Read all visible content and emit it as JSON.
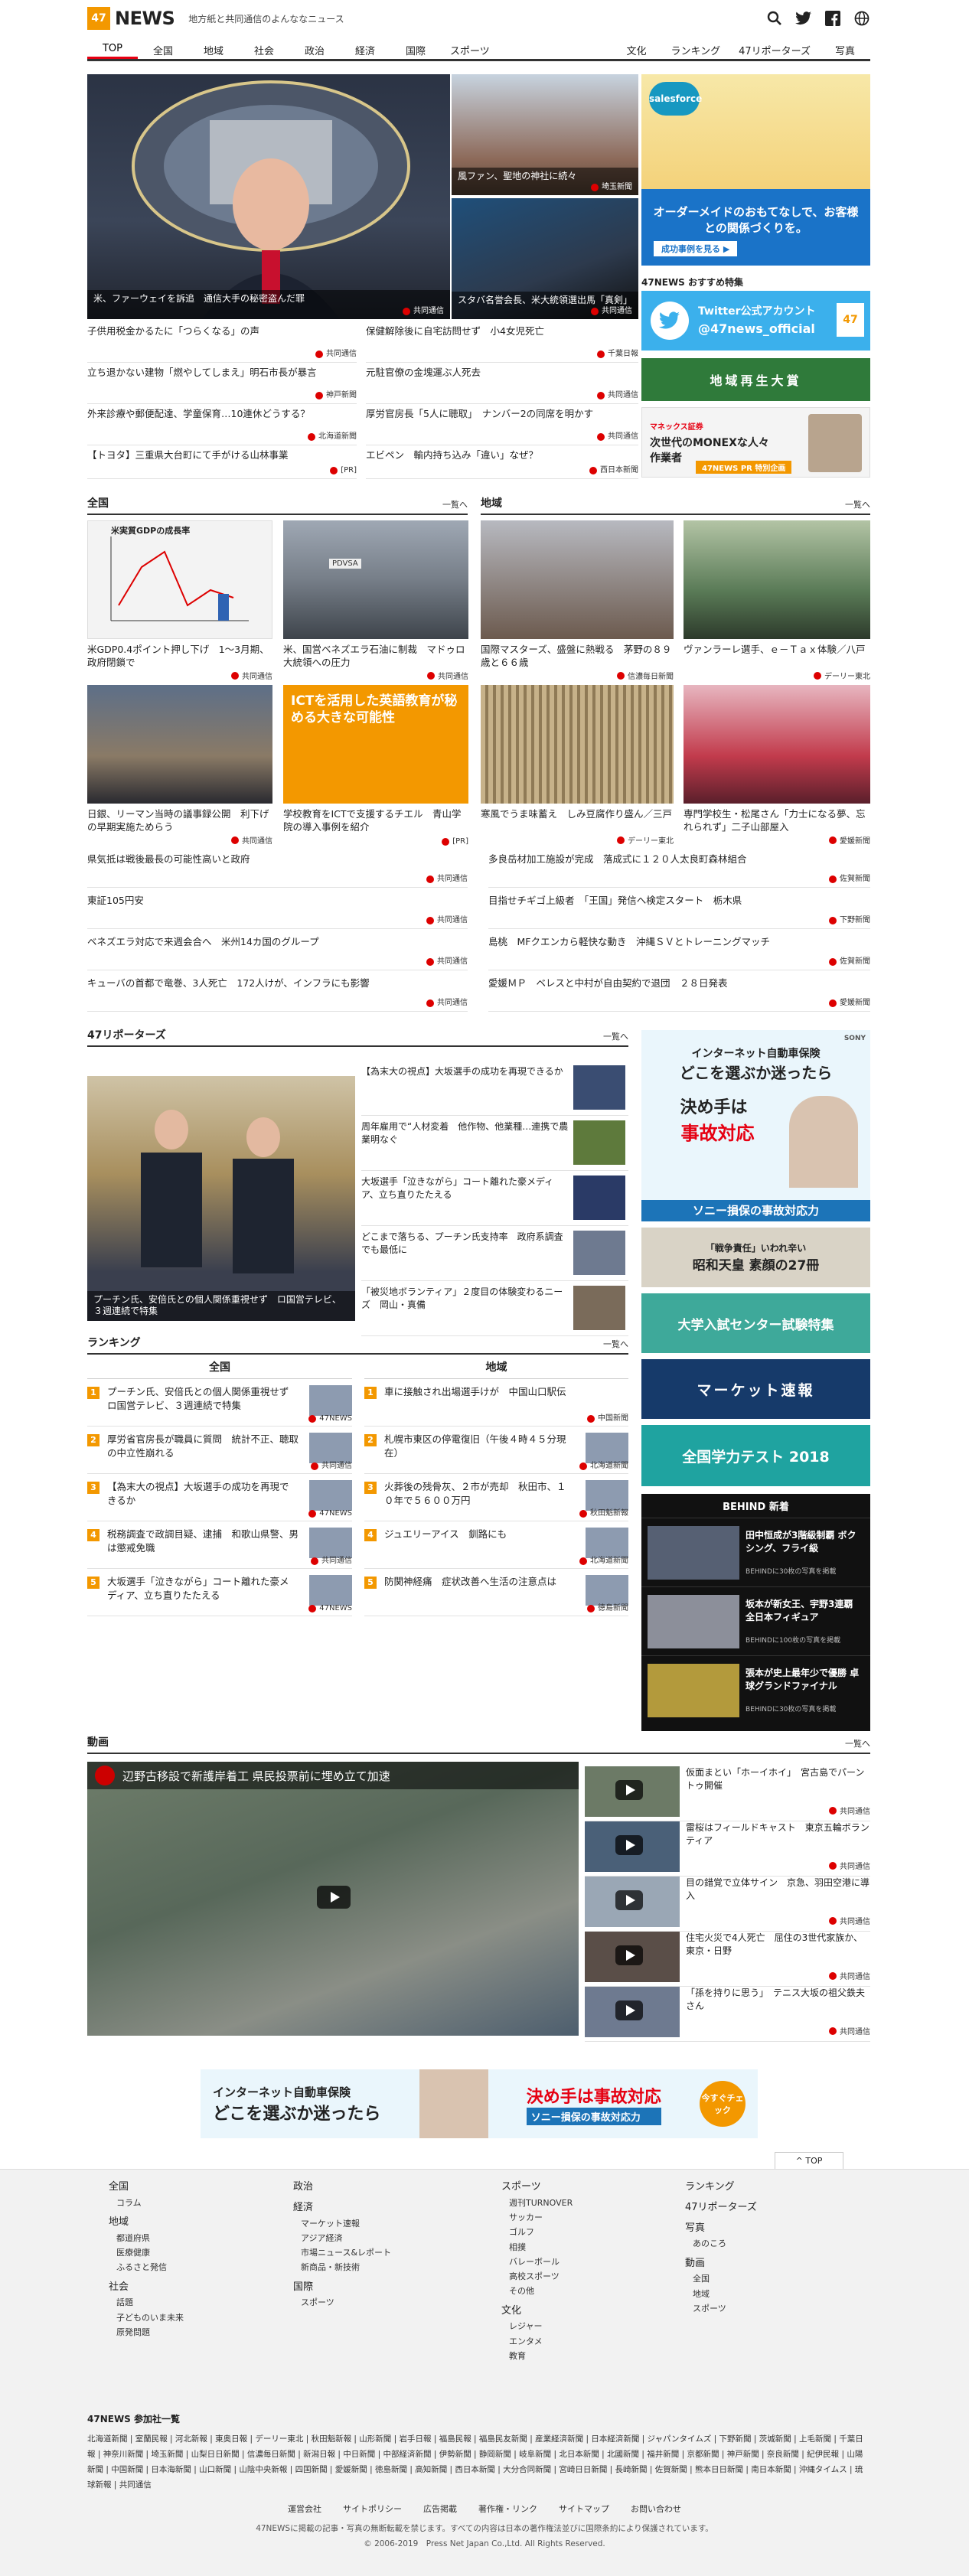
{
  "header": {
    "logo_num": "47",
    "logo_text": "NEWS",
    "tagline": "地方紙と共同通信のよんななニュース"
  },
  "nav": [
    "TOP",
    "全国",
    "地域",
    "社会",
    "政治",
    "経済",
    "国際",
    "スポーツ",
    "文化",
    "ランキング",
    "47リポーターズ",
    "写真"
  ],
  "hero": {
    "main_caption": "米、ファーウェイを訴追　通信大手の秘密盗んだ罪",
    "main_src": "共同通信",
    "side1_caption": "風ファン、聖地の神社に続々",
    "side1_src": "埼玉新聞",
    "side2_caption": "スタバ名誉会長、米大統領選出馬「真剣」",
    "side2_src": "共同通信"
  },
  "top_headlines": [
    {
      "t": "子供用税金かるたに「つらくなる」の声",
      "s": "共同通信"
    },
    {
      "t": "保健解除後に自宅訪問せず　小4女児死亡",
      "s": "千葉日報"
    },
    {
      "t": "立ち退かない建物「燃やしてしまえ」明石市長が暴言",
      "s": "神戸新聞"
    },
    {
      "t": "元駐官僚の金塊運ぶ人死去",
      "s": "共同通信"
    },
    {
      "t": "外来診療や郵便配達、学童保育…10連休どうする？",
      "s": "北海道新聞"
    },
    {
      "t": "厚労官房長「5人に聴取」　ナンバー2の同席を明かす",
      "s": "共同通信"
    },
    {
      "t": "【トヨタ】三重県大台町にて手がける山林事業",
      "s": "[PR]"
    },
    {
      "t": "エビペン　輸内持ち込み「違い」なぜ？",
      "s": "西日本新聞"
    }
  ],
  "right_ads": {
    "salesforce_title": "オーダーメイドのおもてなしで、お客様との関係づくりを。",
    "salesforce_btn": "成功事例を見る ▶",
    "recommend_title": "47NEWS おすすめ特集",
    "twitter_title": "Twitter公式アカウント",
    "twitter_handle": "@47news_official",
    "chiiki": "地域再生大賞",
    "monex_brand": "マネックス証券",
    "monex_title": "次世代のMONEXな人々",
    "monex_sub": "作業者",
    "monex_pr": "47NEWS PR 特別企画"
  },
  "zenkoku": {
    "title": "全国",
    "more": "一覧へ",
    "cards": [
      {
        "t": "米GDP0.4ポイント押し下げ　1～3月期、政府閉鎖で",
        "s": "共同通信",
        "ph": "米実質GDPの成長率"
      },
      {
        "t": "米、国営ベネズエラ石油に制裁　マドゥロ大統領への圧力",
        "s": "共同通信",
        "ph": "PDVSA"
      },
      {
        "t": "日銀、リーマン当時の議事録公開　利下げの早期実施ためらう",
        "s": "共同通信",
        "ph": ""
      },
      {
        "t": "学校教育をICTで支援するチエル　青山学院の導入事例を紹介",
        "s": "[PR]",
        "ph": "ICTを活用した英語教育が秘める大きな可能性"
      }
    ],
    "list": [
      {
        "t": "県気抵は戦後最長の可能性高いと政府",
        "s": "共同通信"
      },
      {
        "t": "東証105円安",
        "s": "共同通信"
      },
      {
        "t": "ベネズエラ対応で来週会合へ　米州14カ国のグループ",
        "s": "共同通信"
      },
      {
        "t": "キューバの首都で竜巻、3人死亡　172人けが、インフラにも影響",
        "s": "共同通信"
      }
    ]
  },
  "chiiki": {
    "title": "地域",
    "more": "一覧へ",
    "cards": [
      {
        "t": "国際マスターズ、盛盤に熱戦る　茅野の８９歳と６６歳",
        "s": "信濃毎日新聞"
      },
      {
        "t": "ヴァンラーレ選手、ｅ－Ｔａｘ体験／八戸",
        "s": "デーリー東北"
      },
      {
        "t": "寒風でうま味蓄え　しみ豆腐作り盛ん／三戸",
        "s": "デーリー東北"
      },
      {
        "t": "専門学校生・松尾さん「力士になる夢、忘れられず」二子山部屋入",
        "s": "愛媛新聞"
      }
    ],
    "list": [
      {
        "t": "多良岳材加工施設が完成　落成式に１２０人太良町森林組合",
        "s": "佐賀新聞"
      },
      {
        "t": "目指せチギゴ上級者　「王国」発信へ検定スタート　栃木県",
        "s": "下野新聞"
      },
      {
        "t": "島桃　MFクエンカら軽快な動き　沖縄ＳＶとトレーニングマッチ",
        "s": "佐賀新聞"
      },
      {
        "t": "愛媛ＭＰ　ベレスと中村が自由契約で退団　２８日発表",
        "s": "愛媛新聞"
      }
    ]
  },
  "reporters": {
    "title": "47リポーターズ",
    "more": "一覧へ",
    "main_caption": "プーチン氏、安倍氏との個人関係重視せず　ロ国営テレビ、３週連続で特集",
    "items": [
      "【為末大の視点】大坂選手の成功を再現できるか",
      "周年雇用で“人材変着　他作物、他業種…連携で農業明なぐ",
      "大坂選手「泣きながら」コート離れた豪メディア、立ち直りたたえる",
      "どこまで落ちる、プーチン氏支持率　政府系調査でも最低に",
      "「被災地ボランティア」２度目の体験変わるニーズ　岡山・真備"
    ]
  },
  "ranking": {
    "title": "ランキング",
    "more": "一覧へ",
    "zenkoku_label": "全国",
    "chiiki_label": "地域",
    "zenkoku": [
      {
        "n": "1",
        "t": "プーチン氏、安倍氏との個人関係重視せず　ロ国営テレビ、３週連続で特集",
        "s": "47NEWS"
      },
      {
        "n": "2",
        "t": "厚労省官房長が職員に質問　統計不正、聴取の中立性崩れる",
        "s": "共同通信"
      },
      {
        "n": "3",
        "t": "【為末大の視点】大坂選手の成功を再現できるか",
        "s": "47NEWS"
      },
      {
        "n": "4",
        "t": "税務調査で政調目疑、逮捕　和歌山県警、男は懲戒免職",
        "s": "共同通信"
      },
      {
        "n": "5",
        "t": "大坂選手「泣きながら」コート離れた豪メディア、立ち直りたたえる",
        "s": "47NEWS"
      }
    ],
    "chiiki": [
      {
        "n": "1",
        "t": "車に接触され出場選手けが　中国山口駅伝",
        "s": "中国新聞"
      },
      {
        "n": "2",
        "t": "札幌市東区の停電復旧（午後４時４５分現在）",
        "s": "北海道新聞"
      },
      {
        "n": "3",
        "t": "火葬後の残骨灰、２市が売却　秋田市、１０年で５６００万円",
        "s": "秋田魁新報"
      },
      {
        "n": "4",
        "t": "ジュエリーアイス　釧路にも",
        "s": "北海道新聞"
      },
      {
        "n": "5",
        "t": "防関神経痛　症状改善へ生活の注意点は",
        "s": "徳島新聞"
      }
    ]
  },
  "side_ads": {
    "sony_title1": "インターネット自動車保険",
    "sony_title2": "どこを選ぶか迷ったら",
    "sony_key": "決め手は",
    "sony_key2": "事故対応",
    "sony_bottom": "ソニー損保の事故対応力",
    "showa": "昭和天皇 素顔の27冊",
    "showa_top": "「戦争責任」いわれ辛い",
    "center": "大学入試センター試験特集",
    "market": "マーケット速報",
    "gakuryoku": "全国学力テスト 2018",
    "behind_title": "BEHIND 新着",
    "behind": [
      {
        "t": "田中恒成が3階級制覇 ボクシング、フライ級",
        "s": "BEHINDに30枚の写真を掲載"
      },
      {
        "t": "坂本が新女王、宇野3連覇 全日本フィギュア",
        "s": "BEHINDに100枚の写真を掲載"
      },
      {
        "t": "張本が史上最年少で優勝 卓球グランドファイナル",
        "s": "BEHINDに30枚の写真を掲載"
      }
    ]
  },
  "video": {
    "title": "動画",
    "more": "一覧へ",
    "main_caption": "辺野古移設で新護岸着工 県民投票前に埋め立て加速",
    "main_src": "共同通信",
    "items": [
      {
        "t": "仮面まとい「ホーイホイ」　宮古島でパーントゥ開催",
        "s": "共同通信"
      },
      {
        "t": "雷桜はフィールドキャスト　東京五輪ボランティア",
        "s": "共同通信"
      },
      {
        "t": "目の錯覚で立体サイン　京急、羽田空港に導入",
        "s": "共同通信"
      },
      {
        "t": "住宅火災で4人死亡　屈住の3世代家族か、東京・日野",
        "s": "共同通信"
      },
      {
        "t": "「孫を持りに思う」　テニス大坂の祖父鉄夫さん",
        "s": "共同通信"
      }
    ]
  },
  "bottom_banner": {
    "l1": "インターネット自動車保険",
    "l2": "どこを選ぶか迷ったら",
    "r1": "決め手は事故対応",
    "r2": "ソニー損保の事故対応力",
    "btn": "今すぐチェック"
  },
  "footer": {
    "totop": "TOP",
    "col1": {
      "a": "全国",
      "a_sub": [
        "コラム"
      ],
      "b": "地域",
      "b_sub": [
        "都道府県",
        "医療健康",
        "ふるさと発信"
      ],
      "c": "社会",
      "c_sub": [
        "話題",
        "子どものいま未来",
        "原発問題"
      ]
    },
    "col2": {
      "a": "政治",
      "b": "経済",
      "b_sub": [
        "マーケット速報",
        "アジア経済",
        "市場ニュース&レポート",
        "新商品・新技術"
      ],
      "c": "国際",
      "c_sub": [
        "スポーツ"
      ]
    },
    "col3": {
      "a": "スポーツ",
      "a_sub": [
        "週刊TURNOVER",
        "サッカー",
        "ゴルフ",
        "相撲",
        "バレーボール",
        "高校スポーツ",
        "その他"
      ],
      "b": "文化",
      "b_sub": [
        "レジャー",
        "エンタメ",
        "教育"
      ]
    },
    "col4": {
      "a": "ランキング",
      "b": "47リポーターズ",
      "c": "写真",
      "c_sub": [
        "あのころ"
      ],
      "d": "動画",
      "d_sub": [
        "全国",
        "地域",
        "スポーツ"
      ]
    },
    "partners_title": "47NEWS 参加社一覧",
    "partners": "北海道新聞 | 室蘭民報 | 河北新報 | 東奥日報 | デーリー東北 | 秋田魁新報 | 山形新聞 | 岩手日報 | 福島民報 | 福島民友新聞 | 産業経済新聞 | 日本経済新聞 | ジャパンタイムズ | 下野新聞 | 茨城新聞 | 上毛新聞 | 千葉日報 | 神奈川新聞 | 埼玉新聞 | 山梨日日新聞 | 信濃毎日新聞 | 新潟日報 | 中日新聞 | 中部経済新聞 | 伊勢新聞 | 静岡新聞 | 岐阜新聞 | 北日本新聞 | 北國新聞 | 福井新聞 | 京都新聞 | 神戸新聞 | 奈良新聞 | 紀伊民報 | 山陽新聞 | 中国新聞 | 日本海新聞 | 山口新聞 | 山陰中央新報 | 四国新聞 | 愛媛新聞 | 徳島新聞 | 高知新聞 | 西日本新聞 | 大分合同新聞 | 宮崎日日新聞 | 長崎新聞 | 佐賀新聞 | 熊本日日新聞 | 南日本新聞 | 沖縄タイムス | 琉球新報 | 共同通信",
    "links": [
      "運営会社",
      "サイトポリシー",
      "広告掲載",
      "著作権・リンク",
      "サイトマップ",
      "お問い合わせ"
    ],
    "note": "47NEWSに掲載の記事・写真の無断転載を禁じます。すべての内容は日本の著作権法並びに国際条約により保護されています。",
    "copyright": "© 2006-2019　Press Net Japan Co.,Ltd. All Rights Reserved."
  },
  "colors": {
    "accent": "#f39800",
    "nav_active": "#e60012",
    "twitter": "#1da1f2"
  }
}
